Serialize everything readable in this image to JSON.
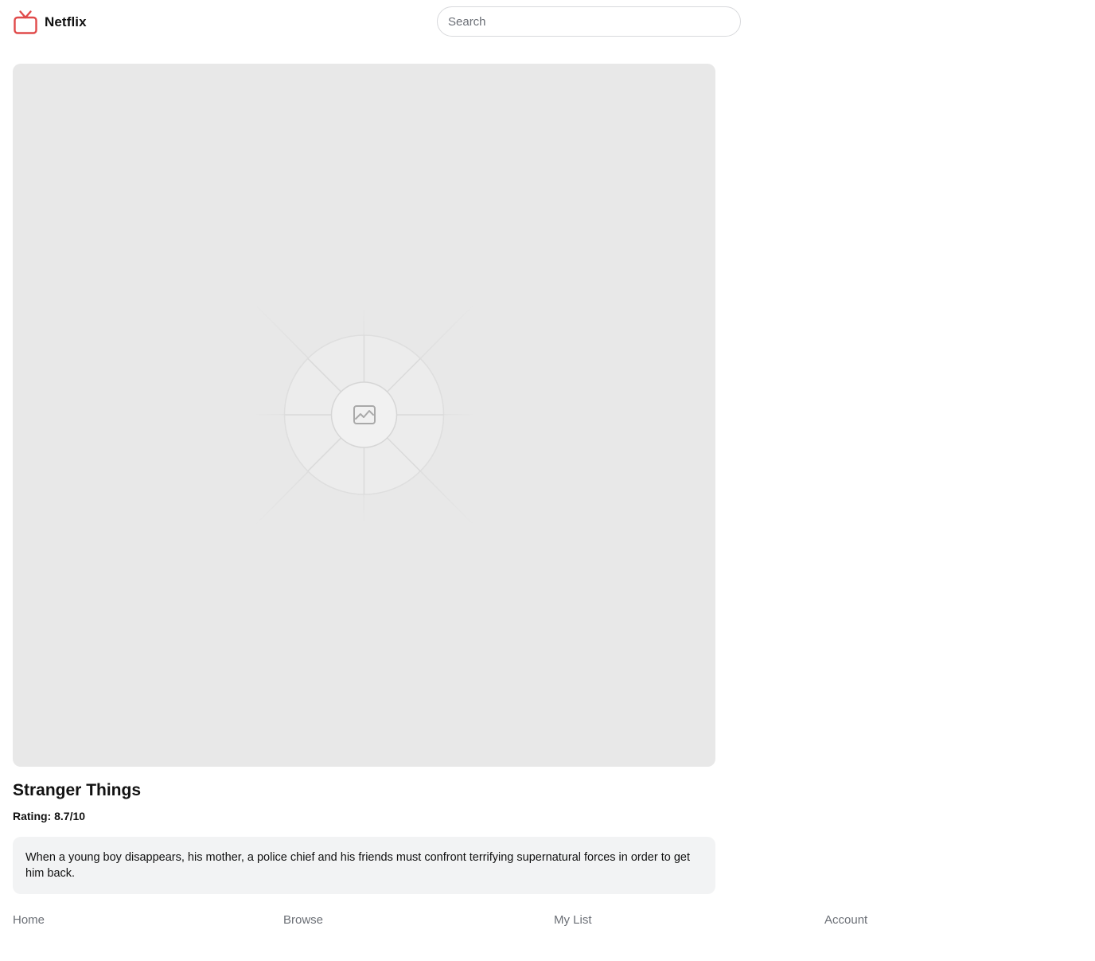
{
  "header": {
    "brand_name": "Netflix",
    "logo_icon": "tv-icon",
    "brand_color": "#e04a4a",
    "search_placeholder": "Search",
    "search_value": ""
  },
  "hero": {
    "placeholder_icon": "image-placeholder-icon",
    "background_color": "#e8e8e8"
  },
  "show": {
    "title": "Stranger Things",
    "rating": "Rating: 8.7/10",
    "description": "When a young boy disappears, his mother, a police chief and his friends must confront terrifying supernatural forces in order to get him back."
  },
  "nav": {
    "items": [
      {
        "label": "Home"
      },
      {
        "label": "Browse"
      },
      {
        "label": "My List"
      },
      {
        "label": "Account"
      }
    ]
  }
}
